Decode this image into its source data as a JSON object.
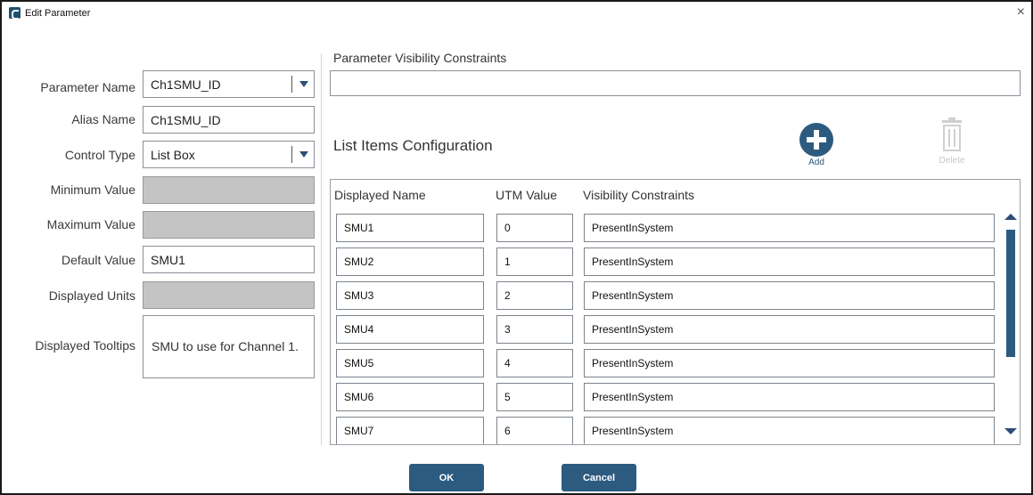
{
  "window": {
    "title": "Edit Parameter",
    "close_glyph": "×"
  },
  "form": {
    "parameter_name": {
      "label": "Parameter Name",
      "value": "Ch1SMU_ID"
    },
    "alias_name": {
      "label": "Alias Name",
      "value": "Ch1SMU_ID"
    },
    "control_type": {
      "label": "Control Type",
      "value": "List Box"
    },
    "minimum_value": {
      "label": "Minimum Value",
      "value": ""
    },
    "maximum_value": {
      "label": "Maximum Value",
      "value": ""
    },
    "default_value": {
      "label": "Default Value",
      "value": "SMU1"
    },
    "displayed_units": {
      "label": "Displayed Units",
      "value": ""
    },
    "displayed_tooltips": {
      "label": "Displayed Tooltips",
      "value": "SMU to use for Channel 1."
    }
  },
  "visibility": {
    "title": "Parameter Visibility Constraints",
    "value": ""
  },
  "list_config": {
    "title": "List Items Configuration",
    "add_label": "Add",
    "delete_label": "Delete",
    "columns": [
      "Displayed Name",
      "UTM Value",
      "Visibility Constraints"
    ],
    "rows": [
      {
        "name": "SMU1",
        "utm": "0",
        "constraint": "PresentInSystem"
      },
      {
        "name": "SMU2",
        "utm": "1",
        "constraint": "PresentInSystem"
      },
      {
        "name": "SMU3",
        "utm": "2",
        "constraint": "PresentInSystem"
      },
      {
        "name": "SMU4",
        "utm": "3",
        "constraint": "PresentInSystem"
      },
      {
        "name": "SMU5",
        "utm": "4",
        "constraint": "PresentInSystem"
      },
      {
        "name": "SMU6",
        "utm": "5",
        "constraint": "PresentInSystem"
      },
      {
        "name": "SMU7",
        "utm": "6",
        "constraint": "PresentInSystem"
      }
    ]
  },
  "buttons": {
    "ok": "OK",
    "cancel": "Cancel"
  },
  "colors": {
    "accent": "#2d5b80",
    "disabled_field": "#c4c4c4"
  }
}
